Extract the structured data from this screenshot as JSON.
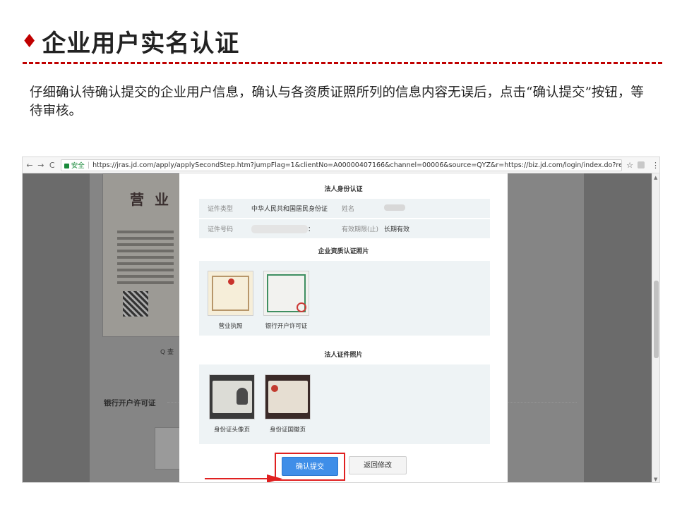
{
  "slide": {
    "title": "企业用户实名认证",
    "instruction": "仔细确认待确认提交的企业用户信息，确认与各资质证照所列的信息内容无误后，点击“确认提交”按钮，等待审核。"
  },
  "browser": {
    "nav": {
      "back": "←",
      "forward": "→",
      "reload": "C"
    },
    "secure_label": "安全",
    "url": "https://jras.jd.com/apply/applySecondStep.htm?jumpFlag=1&clientNo=A00000407166&channel=00006&source=QYZ&r=https://biz.jd.com/login/index.do?retur..."
  },
  "background_page": {
    "license_heading": "营 业",
    "view_link": "Q 查",
    "bank_section_label": "银行开户许可证"
  },
  "modal": {
    "legal_person_section": "法人身份认证",
    "fields": {
      "doc_type_label": "证件类型",
      "doc_type_value": "中华人民共和国居民身份证",
      "name_label": "姓名",
      "id_label": "证件号码",
      "id_suffix": "：",
      "validity_label": "有效期限(止)",
      "validity_value": "长期有效"
    },
    "qualification_section": "企业资质认证照片",
    "qualification_photos": [
      {
        "caption": "营业执照"
      },
      {
        "caption": "银行开户许可证"
      }
    ],
    "legal_photo_section": "法人证件照片",
    "legal_photos": [
      {
        "caption": "身份证头像页"
      },
      {
        "caption": "身份证国徽页"
      }
    ],
    "submit_label": "确认提交",
    "back_label": "返回修改"
  },
  "colors": {
    "accent_red": "#c00000",
    "highlight_red": "#e02020",
    "primary_blue": "#3f8ee8",
    "panel_bg": "#eef3f5"
  }
}
